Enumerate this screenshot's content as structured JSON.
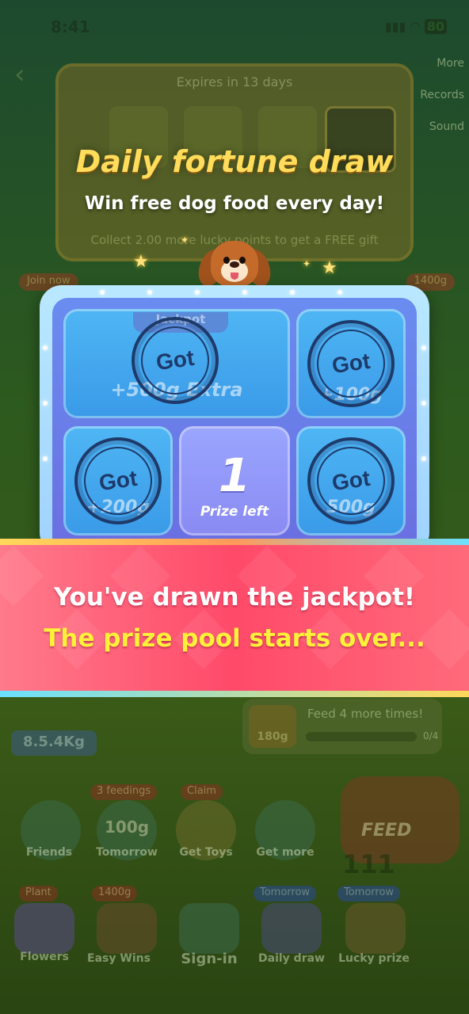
{
  "status_bar": {
    "time": "8:41",
    "battery": "80"
  },
  "background": {
    "side_links": [
      "More",
      "Records",
      "Sound"
    ],
    "expires_text": "Expires in 13 days",
    "collect_text": "Collect 2.00 more lucky points to get a FREE gift",
    "left_badge": "Join now",
    "right_badge": "1400g",
    "weight": "8.5.4Kg",
    "feed_hint": "Feed 4 more times!",
    "feed_progress": "0/4",
    "feed_bowl_amount": "180g",
    "feed_button": "FEED",
    "feed_count": "111",
    "tiles_row1": [
      {
        "label": "Friends",
        "badge": ""
      },
      {
        "label": "Tomorrow",
        "badge": "3 feedings",
        "amount": "100g"
      },
      {
        "label": "Get Toys",
        "badge": "Claim"
      },
      {
        "label": "Get more",
        "badge": ""
      }
    ],
    "tiles_row2": [
      {
        "label": "Flowers",
        "badge": "Plant"
      },
      {
        "label": "Easy Wins",
        "badge": "1400g"
      },
      {
        "label": "Sign-in",
        "badge": ""
      },
      {
        "label": "Daily draw",
        "badge": "Tomorrow"
      },
      {
        "label": "Lucky prize",
        "badge": "Tomorrow"
      }
    ]
  },
  "overlay": {
    "title": "Daily fortune draw",
    "subtitle": "Win free dog food every day!",
    "board": {
      "jackpot_tab": "Jackpot",
      "cells": [
        {
          "prize": "+500g Extra",
          "stamp": "Got"
        },
        {
          "prize": "+100g",
          "stamp": "Got"
        },
        {
          "prize": "+200g",
          "stamp": "Got"
        },
        {
          "prize": "500g",
          "stamp": "Got"
        }
      ],
      "center_count": "1",
      "center_label": "Prize left"
    },
    "banner": {
      "line1": "You've drawn the jackpot!",
      "line2": "The prize pool starts over..."
    }
  },
  "colors": {
    "title_gold": "#ffdc5a",
    "banner_pink": "#ff4a6a",
    "banner_yellow": "#fff13a",
    "stamp_navy": "#1e3a6a"
  }
}
